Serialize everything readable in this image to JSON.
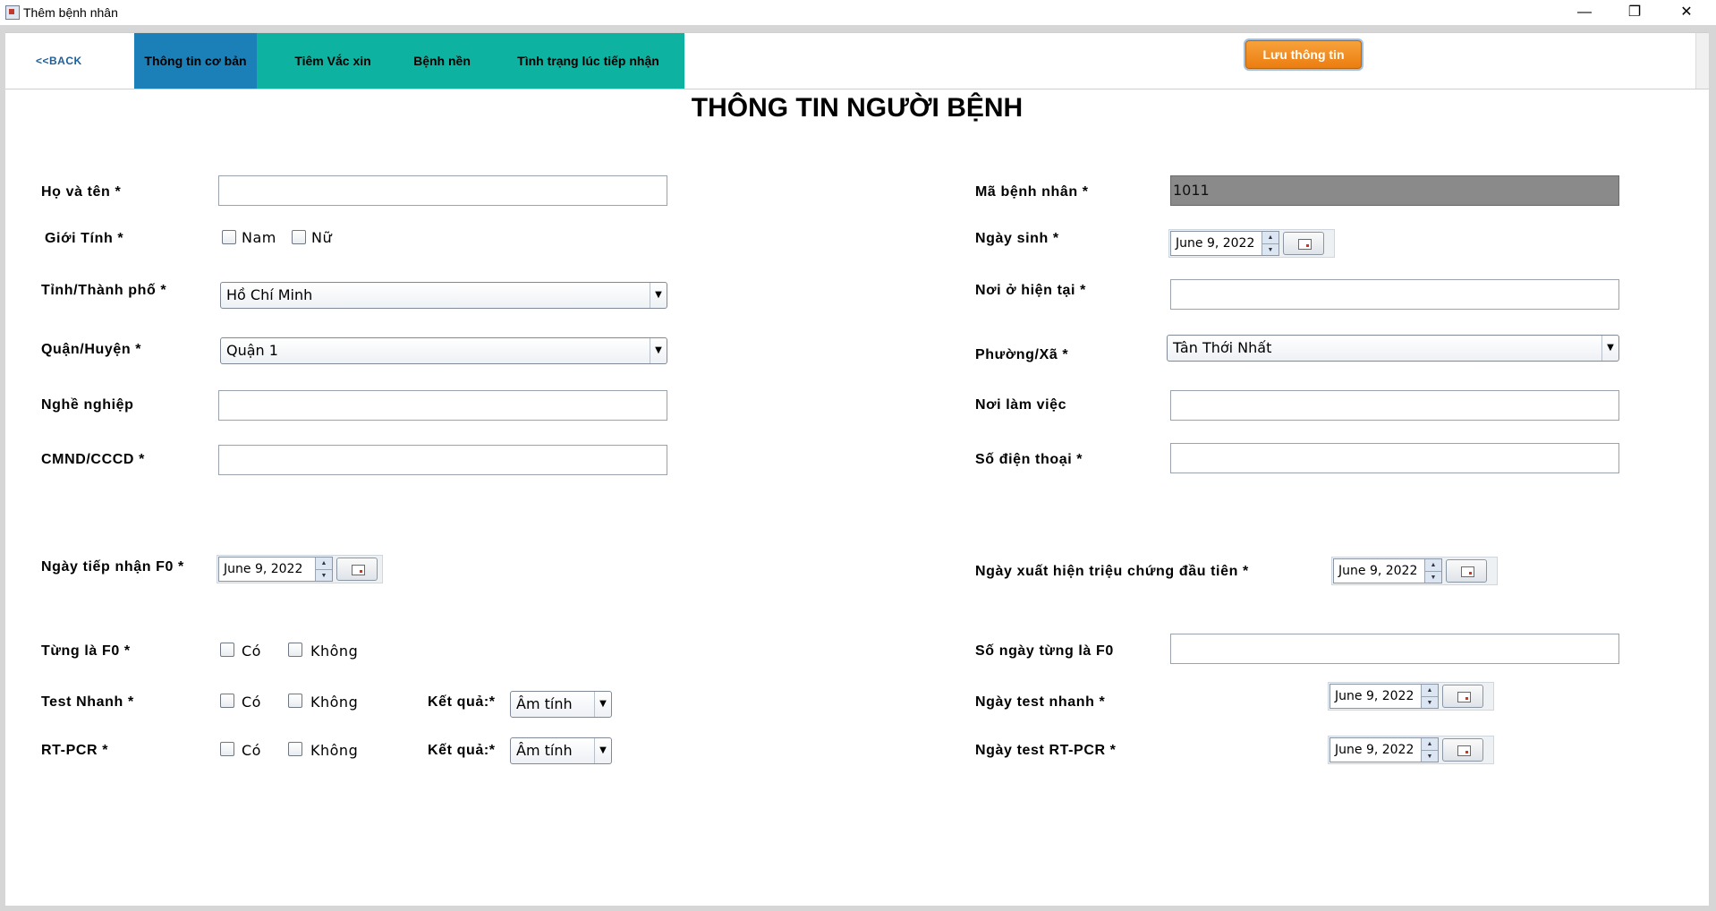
{
  "window": {
    "title": "Thêm bệnh nhân",
    "minimize": "—",
    "restore": "❐",
    "close": "✕"
  },
  "nav": {
    "back": "<<BACK",
    "tabs": [
      {
        "label": "Thông tin cơ bản",
        "active": true
      },
      {
        "label": "Tiêm Vắc xin",
        "active": false
      },
      {
        "label": "Bệnh nền",
        "active": false
      },
      {
        "label": "Tình trạng lúc tiếp nhận",
        "active": false
      }
    ],
    "save": "Lưu thông tin"
  },
  "heading": "THÔNG TIN NGƯỜI BỆNH",
  "left": {
    "name_label": "Họ và tên *",
    "name_value": "",
    "gender_label": "Giới Tính *",
    "gender_male": "Nam",
    "gender_female": "Nữ",
    "province_label": "Tỉnh/Thành phố *",
    "province_value": "Hồ Chí Minh",
    "district_label": "Quận/Huyện *",
    "district_value": "Quận 1",
    "job_label": "Nghề nghiệp",
    "job_value": "",
    "id_label": "CMND/CCCD *",
    "id_value": "",
    "admit_label": "Ngày tiếp nhận F0 *",
    "admit_date": "June 9, 2022",
    "wasf0_label": "Từng là F0 *",
    "rapid_label": "Test Nhanh *",
    "pcr_label": "RT-PCR *",
    "yes": "Có",
    "no": "Không",
    "result_label": "Kết quả:*",
    "rapid_result": "Âm tính",
    "pcr_result": "Âm tính"
  },
  "right": {
    "code_label": "Mã bệnh nhân *",
    "code_value": "1011",
    "dob_label": "Ngày sinh *",
    "dob_value": "June 9, 2022",
    "address_label": "Nơi ở hiện tại *",
    "address_value": "",
    "ward_label": "Phường/Xã *",
    "ward_value": "Tân Thới Nhất",
    "work_label": "Nơi làm việc",
    "work_value": "",
    "phone_label": "Số điện thoại *",
    "phone_value": "",
    "symptom_label": "Ngày xuất hiện triệu chứng đầu tiên *",
    "symptom_date": "June 9, 2022",
    "days_f0_label": "Số ngày từng là F0",
    "days_f0_value": "",
    "rapid_date_label": "Ngày test nhanh *",
    "rapid_date": "June 9, 2022",
    "pcr_date_label": "Ngày test RT-PCR *",
    "pcr_date": "June 9, 2022"
  }
}
